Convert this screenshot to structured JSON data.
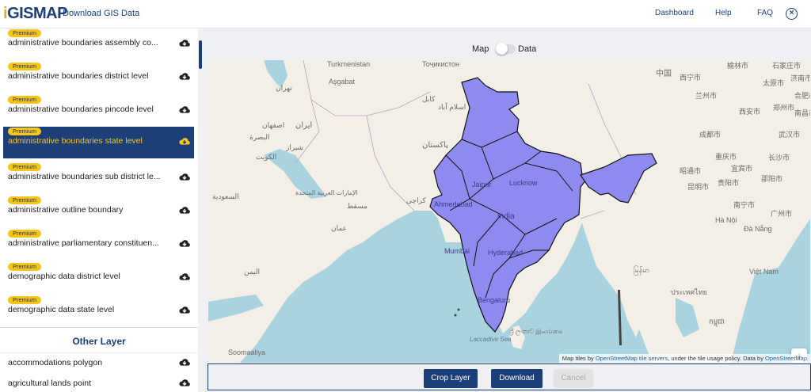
{
  "header": {
    "logo_i": "i",
    "logo_rest": "GISMAP",
    "subtitle": "Download GIS Data",
    "nav": [
      "Dashboard",
      "Help",
      "FAQ"
    ],
    "close_icon": "close-circle-icon"
  },
  "colors": {
    "brand_navy": "#1c3f7a",
    "premium_yellow": "#f5c518",
    "selection_bg": "#1c3f7a",
    "india_fill": "#8e8af0",
    "water": "#a9d3df",
    "land": "#f3efe7"
  },
  "sidebar": {
    "premium_label": "Premium",
    "layers": [
      {
        "name": "administrative boundaries assembly co...",
        "premium": true,
        "selected": false
      },
      {
        "name": "administrative boundaries district level",
        "premium": true,
        "selected": false
      },
      {
        "name": "administrative boundaries pincode level",
        "premium": true,
        "selected": false
      },
      {
        "name": "administrative boundaries state level",
        "premium": true,
        "selected": true
      },
      {
        "name": "administrative boundaries sub district le...",
        "premium": true,
        "selected": false
      },
      {
        "name": "administrative outline boundary",
        "premium": true,
        "selected": false
      },
      {
        "name": "administrative parliamentary constituen...",
        "premium": true,
        "selected": false
      },
      {
        "name": "demographic data district level",
        "premium": true,
        "selected": false
      },
      {
        "name": "demographic data state level",
        "premium": true,
        "selected": false
      }
    ],
    "other_layer_title": "Other Layer",
    "other_layers": [
      {
        "name": "accommodations polygon"
      },
      {
        "name": "agricultural lands point"
      }
    ]
  },
  "view_toggle": {
    "left_label": "Map",
    "right_label": "Data",
    "active": "Map"
  },
  "map": {
    "labels": {
      "china": "中国",
      "india": "India",
      "pakistan": "پاکستان",
      "iran": "ایران",
      "jaipur": "Jaipur",
      "lucknow": "Lucknow",
      "ahmedabad": "Ahmedabad",
      "mumbai": "Mumbai",
      "hyderabad": "Hyderabad",
      "bengaluru": "Bengaluru",
      "sri_lanka": "ශ්‍රී ලංකාව\nஇலங்கை",
      "viet_nam": "Việt Nam",
      "ha_noi": "Hà Nội",
      "kuwait": "الكويت",
      "oman": "عمان",
      "yemen": "اليمن",
      "somaliland": "Soomaaliya",
      "uae": "الإمارات العربية المتحدة",
      "saudi": "السعودية",
      "turkmenistan": "Turkmenistan",
      "tajikistan": "Тоҷикистон",
      "ashgabat": "Aşgabat",
      "tehran": "تهران",
      "esfahan": "اصفهان",
      "shiraz": "شیراز",
      "basra": "البصرة",
      "kabul": "کابل",
      "islamabad": "اسلام آباد",
      "karachi": "کراچی",
      "muscat": "مسقط",
      "laccadive": "Laccadive\nSea",
      "xining": "西宁市",
      "lanzhou": "兰州市",
      "xian": "西安市",
      "chengdu": "成都市",
      "chongqing": "重庆市",
      "kunming": "昆明市",
      "guiyang": "贵阳市",
      "nanning": "南宁市",
      "wuhan": "武汉市",
      "changsha": "长沙市",
      "zhengzhou": "郑州市",
      "taiyuan": "太原市",
      "yulin": "榆林市",
      "shijiazhuang": "石家庄市",
      "jinan": "济南市",
      "hefei": "合肥市",
      "nanchang": "南昌市",
      "shaoyang": "邵阳市",
      "guangzhou": "广州市",
      "zhaotong": "昭通市",
      "yibin": "宜宾市",
      "myanmar": "မြန်မာ",
      "thailand": "ประเทศไทย",
      "cambodia": "កម្ពុជា",
      "da_nang": "Đà Nẵng"
    },
    "zoom_in": "+",
    "zoom_out": "−",
    "attribution_pre": "Map tiles by ",
    "attribution_link1": "OpenStreetMap tile servers",
    "attribution_mid": ", under the tile usage policy. Data by ",
    "attribution_link2": "OpenStreetMap"
  },
  "actions": {
    "crop": "Crop Layer",
    "download": "Download",
    "cancel": "Cancel"
  }
}
